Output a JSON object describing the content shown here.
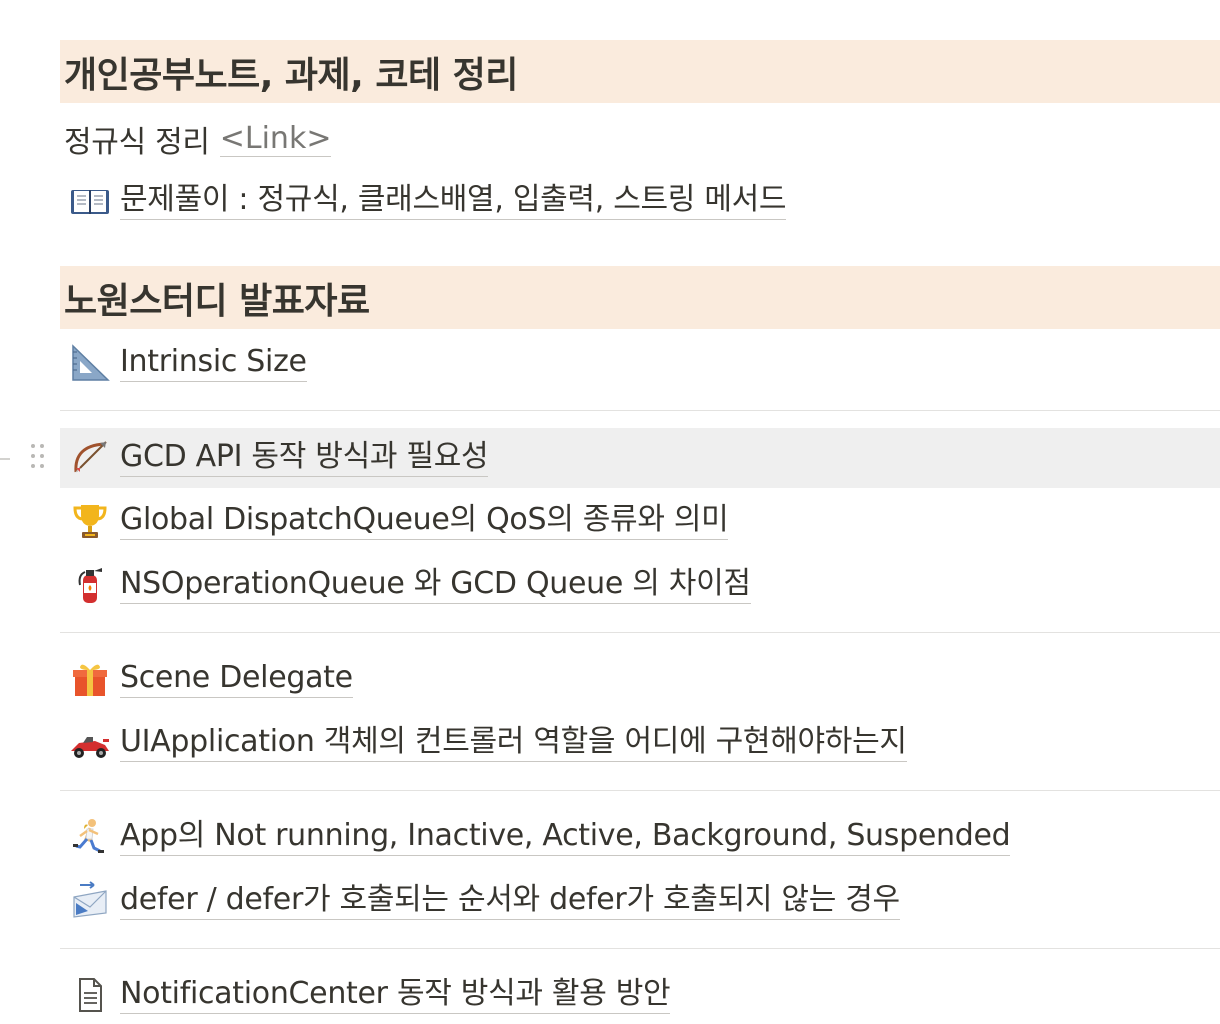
{
  "sections": [
    {
      "title": "개인공부노트, 과제, 코테 정리"
    },
    {
      "title": "노원스터디 발표자료"
    }
  ],
  "study_notes": {
    "regex_label": "정규식 정리",
    "regex_link": "<Link>",
    "problem_solving": {
      "icon": "open-book-icon",
      "label": "문제풀이 : 정규식, 클래스배열, 입출력, 스트링 메서드"
    }
  },
  "pages": [
    {
      "icon": "triangular-ruler-icon",
      "label": "Intrinsic Size"
    },
    {
      "icon": "bow-and-arrow-icon",
      "label": "GCD API 동작 방식과 필요성"
    },
    {
      "icon": "trophy-icon",
      "label": "Global DispatchQueue의 QoS의 종류와 의미"
    },
    {
      "icon": "fire-extinguisher-icon",
      "label": "NSOperationQueue 와 GCD Queue 의 차이점"
    },
    {
      "icon": "gift-icon",
      "label": "Scene Delegate"
    },
    {
      "icon": "racing-car-icon",
      "label": "UIApplication 객체의 컨트롤러 역할을 어디에 구현해야하는지"
    },
    {
      "icon": "runner-icon",
      "label": "App의 Not running, Inactive, Active, Background, Suspended"
    },
    {
      "icon": "incoming-envelope-icon",
      "label": "defer / defer가 호출되는 순서와 defer가 호출되지 않는 경우"
    },
    {
      "icon": "page-document-icon",
      "label": "NotificationCenter 동작 방식과 활용 방안"
    }
  ],
  "colors": {
    "section_header_bg": "#faebdd",
    "text": "#37352f",
    "hover_row_bg": "#efefef",
    "divider": "#e3e2e0"
  }
}
